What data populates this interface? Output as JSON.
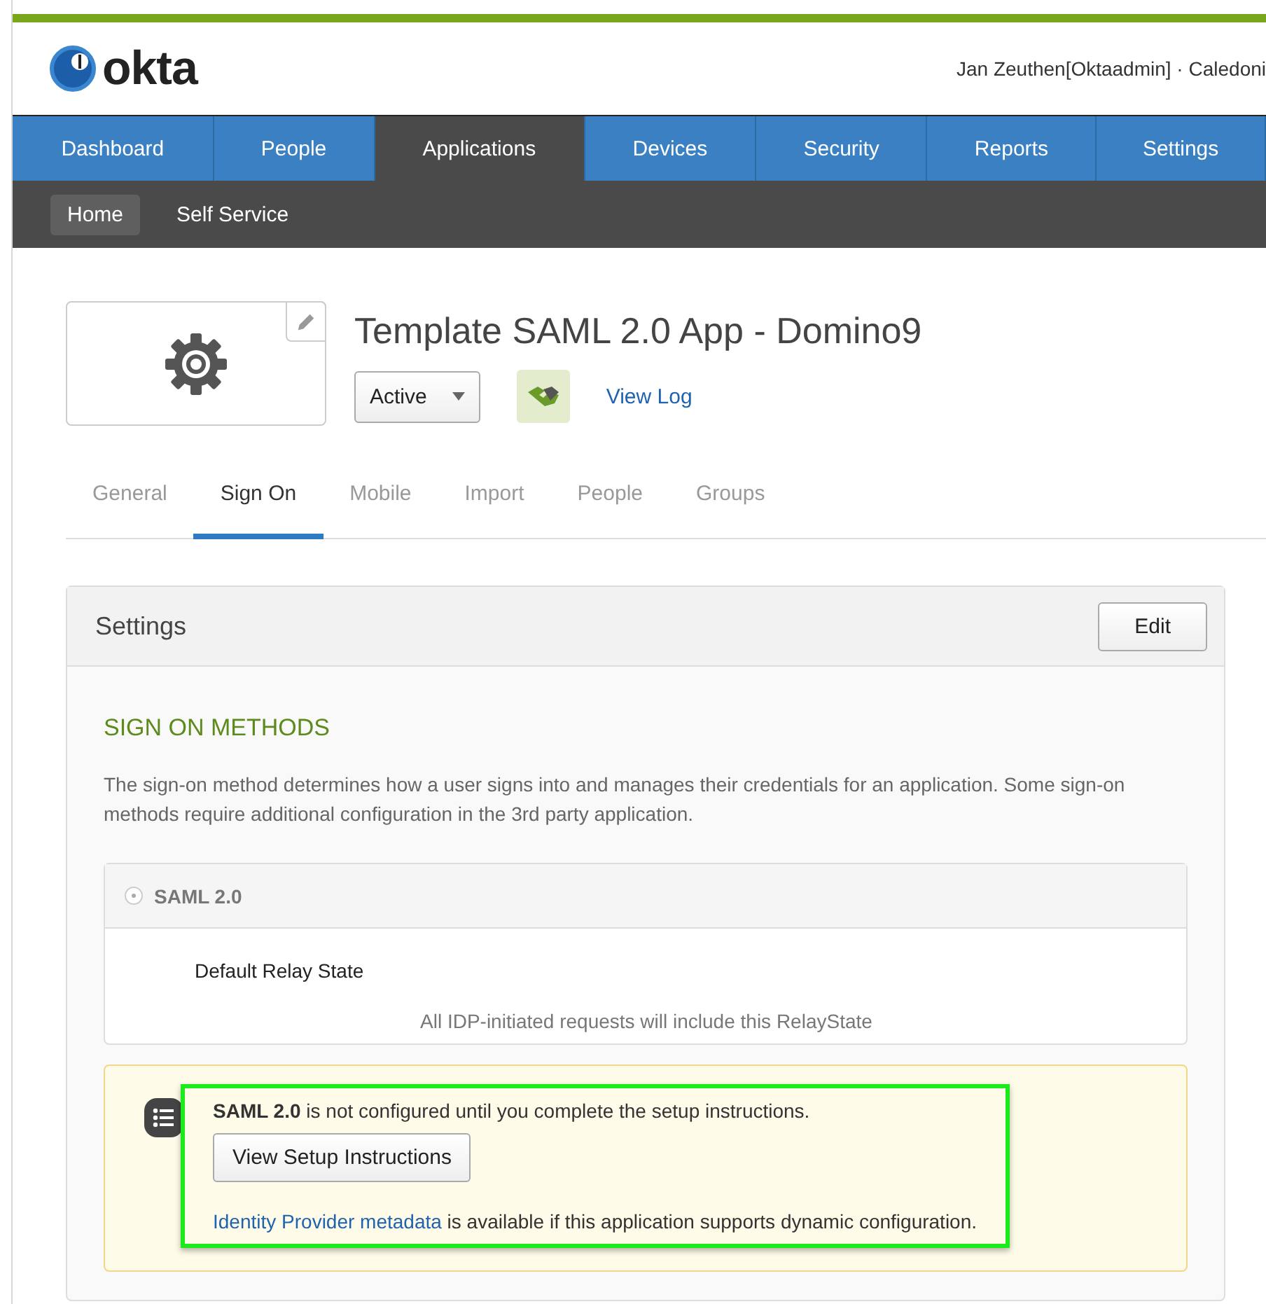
{
  "header": {
    "logo": "okta",
    "user": "Jan Zeuthen[Oktaadmin] · Caledoni"
  },
  "nav": [
    {
      "label": "Dashboard",
      "selected": false
    },
    {
      "label": "People",
      "selected": false
    },
    {
      "label": "Applications",
      "selected": true
    },
    {
      "label": "Devices",
      "selected": false
    },
    {
      "label": "Security",
      "selected": false
    },
    {
      "label": "Reports",
      "selected": false
    },
    {
      "label": "Settings",
      "selected": false
    }
  ],
  "subnav": [
    {
      "label": "Home",
      "selected": true
    },
    {
      "label": "Self Service",
      "selected": false
    }
  ],
  "app": {
    "title": "Template SAML 2.0 App - Domino9",
    "status": "Active",
    "view_log": "View Log"
  },
  "app_tabs": [
    {
      "label": "General",
      "selected": false
    },
    {
      "label": "Sign On",
      "selected": true
    },
    {
      "label": "Mobile",
      "selected": false
    },
    {
      "label": "Import",
      "selected": false
    },
    {
      "label": "People",
      "selected": false
    },
    {
      "label": "Groups",
      "selected": false
    }
  ],
  "settings": {
    "title": "Settings",
    "edit": "Edit",
    "heading": "SIGN ON METHODS",
    "description": "The sign-on method determines how a user signs into and manages their credentials for an application. Some sign-on methods require additional configuration in the 3rd party application.",
    "method": {
      "label": "SAML 2.0",
      "selected": true,
      "field_label": "Default Relay State",
      "hint": "All IDP-initiated requests will include this RelayState"
    }
  },
  "notice": {
    "highlighted": true,
    "message": "**SAML 2.0** is not configured until you complete the setup instructions.",
    "button": "View Setup Instructions",
    "link": "Identity Provider metadata",
    "link_suffix": " is available if this application supports dynamic configuration."
  }
}
